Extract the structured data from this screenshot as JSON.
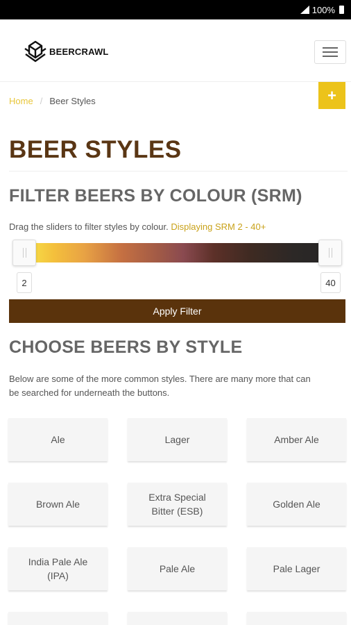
{
  "statusbar": {
    "battery": "100%"
  },
  "header": {
    "logo_text": "BEERCRAWL"
  },
  "breadcrumb": {
    "home": "Home",
    "separator": "/",
    "current": "Beer Styles"
  },
  "fab": {
    "label": "+"
  },
  "page_title": "BEER STYLES",
  "filter": {
    "title": "FILTER BEERS BY COLOUR (SRM)",
    "description": "Drag the sliders to filter styles by colour.",
    "displaying": "Displaying SRM 2 - 40+",
    "min_value": "2",
    "max_value": "40",
    "apply_label": "Apply Filter"
  },
  "styles": {
    "title": "CHOOSE BEERS BY STYLE",
    "description_line1": "Below are some of the more common styles. There are many more that can",
    "description_line2": "be searched for underneath the buttons.",
    "items": [
      {
        "line1": "Ale",
        "line2": ""
      },
      {
        "line1": "Lager",
        "line2": ""
      },
      {
        "line1": "Amber Ale",
        "line2": ""
      },
      {
        "line1": "Brown Ale",
        "line2": ""
      },
      {
        "line1": "Extra Special",
        "line2": "Bitter (ESB)"
      },
      {
        "line1": "Golden Ale",
        "line2": ""
      },
      {
        "line1": "India Pale Ale",
        "line2": "(IPA)"
      },
      {
        "line1": "Pale Ale",
        "line2": ""
      },
      {
        "line1": "Pale Lager",
        "line2": ""
      }
    ]
  },
  "colors": {
    "accent": "#ecc31a",
    "brand_brown": "#5a330c",
    "title_brown": "#5a3614"
  }
}
